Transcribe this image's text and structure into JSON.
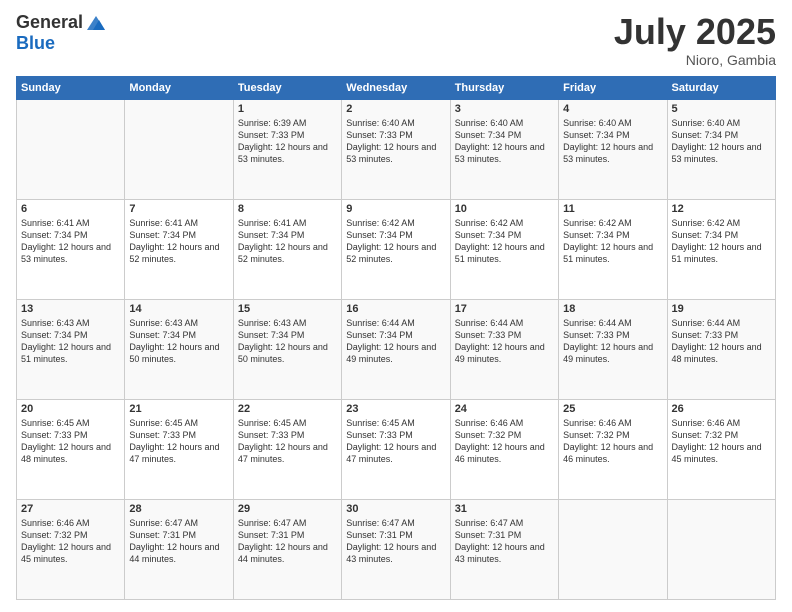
{
  "header": {
    "logo_general": "General",
    "logo_blue": "Blue",
    "month_title": "July 2025",
    "location": "Nioro, Gambia"
  },
  "days_of_week": [
    "Sunday",
    "Monday",
    "Tuesday",
    "Wednesday",
    "Thursday",
    "Friday",
    "Saturday"
  ],
  "weeks": [
    [
      {
        "day": "",
        "sunrise": "",
        "sunset": "",
        "daylight": ""
      },
      {
        "day": "",
        "sunrise": "",
        "sunset": "",
        "daylight": ""
      },
      {
        "day": "1",
        "sunrise": "Sunrise: 6:39 AM",
        "sunset": "Sunset: 7:33 PM",
        "daylight": "Daylight: 12 hours and 53 minutes."
      },
      {
        "day": "2",
        "sunrise": "Sunrise: 6:40 AM",
        "sunset": "Sunset: 7:33 PM",
        "daylight": "Daylight: 12 hours and 53 minutes."
      },
      {
        "day": "3",
        "sunrise": "Sunrise: 6:40 AM",
        "sunset": "Sunset: 7:34 PM",
        "daylight": "Daylight: 12 hours and 53 minutes."
      },
      {
        "day": "4",
        "sunrise": "Sunrise: 6:40 AM",
        "sunset": "Sunset: 7:34 PM",
        "daylight": "Daylight: 12 hours and 53 minutes."
      },
      {
        "day": "5",
        "sunrise": "Sunrise: 6:40 AM",
        "sunset": "Sunset: 7:34 PM",
        "daylight": "Daylight: 12 hours and 53 minutes."
      }
    ],
    [
      {
        "day": "6",
        "sunrise": "Sunrise: 6:41 AM",
        "sunset": "Sunset: 7:34 PM",
        "daylight": "Daylight: 12 hours and 53 minutes."
      },
      {
        "day": "7",
        "sunrise": "Sunrise: 6:41 AM",
        "sunset": "Sunset: 7:34 PM",
        "daylight": "Daylight: 12 hours and 52 minutes."
      },
      {
        "day": "8",
        "sunrise": "Sunrise: 6:41 AM",
        "sunset": "Sunset: 7:34 PM",
        "daylight": "Daylight: 12 hours and 52 minutes."
      },
      {
        "day": "9",
        "sunrise": "Sunrise: 6:42 AM",
        "sunset": "Sunset: 7:34 PM",
        "daylight": "Daylight: 12 hours and 52 minutes."
      },
      {
        "day": "10",
        "sunrise": "Sunrise: 6:42 AM",
        "sunset": "Sunset: 7:34 PM",
        "daylight": "Daylight: 12 hours and 51 minutes."
      },
      {
        "day": "11",
        "sunrise": "Sunrise: 6:42 AM",
        "sunset": "Sunset: 7:34 PM",
        "daylight": "Daylight: 12 hours and 51 minutes."
      },
      {
        "day": "12",
        "sunrise": "Sunrise: 6:42 AM",
        "sunset": "Sunset: 7:34 PM",
        "daylight": "Daylight: 12 hours and 51 minutes."
      }
    ],
    [
      {
        "day": "13",
        "sunrise": "Sunrise: 6:43 AM",
        "sunset": "Sunset: 7:34 PM",
        "daylight": "Daylight: 12 hours and 51 minutes."
      },
      {
        "day": "14",
        "sunrise": "Sunrise: 6:43 AM",
        "sunset": "Sunset: 7:34 PM",
        "daylight": "Daylight: 12 hours and 50 minutes."
      },
      {
        "day": "15",
        "sunrise": "Sunrise: 6:43 AM",
        "sunset": "Sunset: 7:34 PM",
        "daylight": "Daylight: 12 hours and 50 minutes."
      },
      {
        "day": "16",
        "sunrise": "Sunrise: 6:44 AM",
        "sunset": "Sunset: 7:34 PM",
        "daylight": "Daylight: 12 hours and 49 minutes."
      },
      {
        "day": "17",
        "sunrise": "Sunrise: 6:44 AM",
        "sunset": "Sunset: 7:33 PM",
        "daylight": "Daylight: 12 hours and 49 minutes."
      },
      {
        "day": "18",
        "sunrise": "Sunrise: 6:44 AM",
        "sunset": "Sunset: 7:33 PM",
        "daylight": "Daylight: 12 hours and 49 minutes."
      },
      {
        "day": "19",
        "sunrise": "Sunrise: 6:44 AM",
        "sunset": "Sunset: 7:33 PM",
        "daylight": "Daylight: 12 hours and 48 minutes."
      }
    ],
    [
      {
        "day": "20",
        "sunrise": "Sunrise: 6:45 AM",
        "sunset": "Sunset: 7:33 PM",
        "daylight": "Daylight: 12 hours and 48 minutes."
      },
      {
        "day": "21",
        "sunrise": "Sunrise: 6:45 AM",
        "sunset": "Sunset: 7:33 PM",
        "daylight": "Daylight: 12 hours and 47 minutes."
      },
      {
        "day": "22",
        "sunrise": "Sunrise: 6:45 AM",
        "sunset": "Sunset: 7:33 PM",
        "daylight": "Daylight: 12 hours and 47 minutes."
      },
      {
        "day": "23",
        "sunrise": "Sunrise: 6:45 AM",
        "sunset": "Sunset: 7:33 PM",
        "daylight": "Daylight: 12 hours and 47 minutes."
      },
      {
        "day": "24",
        "sunrise": "Sunrise: 6:46 AM",
        "sunset": "Sunset: 7:32 PM",
        "daylight": "Daylight: 12 hours and 46 minutes."
      },
      {
        "day": "25",
        "sunrise": "Sunrise: 6:46 AM",
        "sunset": "Sunset: 7:32 PM",
        "daylight": "Daylight: 12 hours and 46 minutes."
      },
      {
        "day": "26",
        "sunrise": "Sunrise: 6:46 AM",
        "sunset": "Sunset: 7:32 PM",
        "daylight": "Daylight: 12 hours and 45 minutes."
      }
    ],
    [
      {
        "day": "27",
        "sunrise": "Sunrise: 6:46 AM",
        "sunset": "Sunset: 7:32 PM",
        "daylight": "Daylight: 12 hours and 45 minutes."
      },
      {
        "day": "28",
        "sunrise": "Sunrise: 6:47 AM",
        "sunset": "Sunset: 7:31 PM",
        "daylight": "Daylight: 12 hours and 44 minutes."
      },
      {
        "day": "29",
        "sunrise": "Sunrise: 6:47 AM",
        "sunset": "Sunset: 7:31 PM",
        "daylight": "Daylight: 12 hours and 44 minutes."
      },
      {
        "day": "30",
        "sunrise": "Sunrise: 6:47 AM",
        "sunset": "Sunset: 7:31 PM",
        "daylight": "Daylight: 12 hours and 43 minutes."
      },
      {
        "day": "31",
        "sunrise": "Sunrise: 6:47 AM",
        "sunset": "Sunset: 7:31 PM",
        "daylight": "Daylight: 12 hours and 43 minutes."
      },
      {
        "day": "",
        "sunrise": "",
        "sunset": "",
        "daylight": ""
      },
      {
        "day": "",
        "sunrise": "",
        "sunset": "",
        "daylight": ""
      }
    ]
  ]
}
